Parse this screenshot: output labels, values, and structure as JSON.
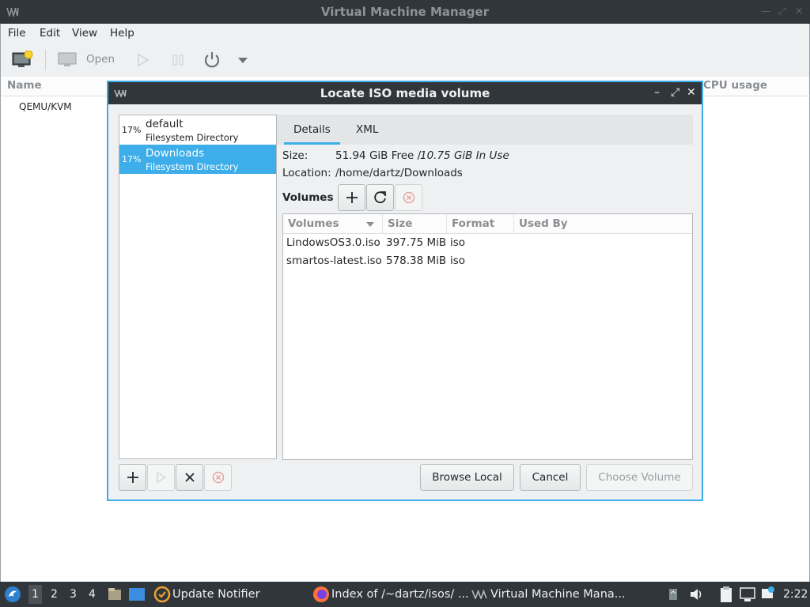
{
  "main_window": {
    "title": "Virtual Machine Manager",
    "menu": [
      "File",
      "Edit",
      "View",
      "Help"
    ],
    "toolbar": {
      "open_label": "Open"
    },
    "columns": {
      "name": "Name",
      "cpu": "CPU usage"
    },
    "connections": [
      "QEMU/KVM"
    ]
  },
  "dialog": {
    "title": "Locate ISO media volume",
    "pools": [
      {
        "percent": "17%",
        "name": "default",
        "type": "Filesystem Directory",
        "selected": false
      },
      {
        "percent": "17%",
        "name": "Downloads",
        "type": "Filesystem Directory",
        "selected": true
      }
    ],
    "tabs": [
      "Details",
      "XML"
    ],
    "active_tab": "Details",
    "size_label": "Size:",
    "size_free": "51.94 GiB Free /",
    "size_in_use": "10.75 GiB In Use",
    "location_label": "Location:",
    "location_value": "/home/dartz/Downloads",
    "volumes_label": "Volumes",
    "volume_columns": [
      "Volumes",
      "Size",
      "Format",
      "Used By"
    ],
    "volumes": [
      {
        "name": "LindowsOS3.0.iso",
        "size": "397.75 MiB",
        "format": "iso",
        "used_by": ""
      },
      {
        "name": "smartos-latest.iso",
        "size": "578.38 MiB",
        "format": "iso",
        "used_by": ""
      }
    ],
    "buttons": {
      "browse_local": "Browse Local",
      "cancel": "Cancel",
      "choose_volume": "Choose Volume"
    }
  },
  "taskbar": {
    "workspaces": [
      "1",
      "2",
      "3",
      "4"
    ],
    "active_workspace": "1",
    "tasks": [
      "Update Notifier",
      "Index of /~dartz/isos/ ...",
      "Virtual Machine Mana..."
    ],
    "clock": "2:22"
  },
  "colors": {
    "accent": "#3daee9",
    "titlebar": "#31363b",
    "window_bg": "#eff0f1"
  }
}
